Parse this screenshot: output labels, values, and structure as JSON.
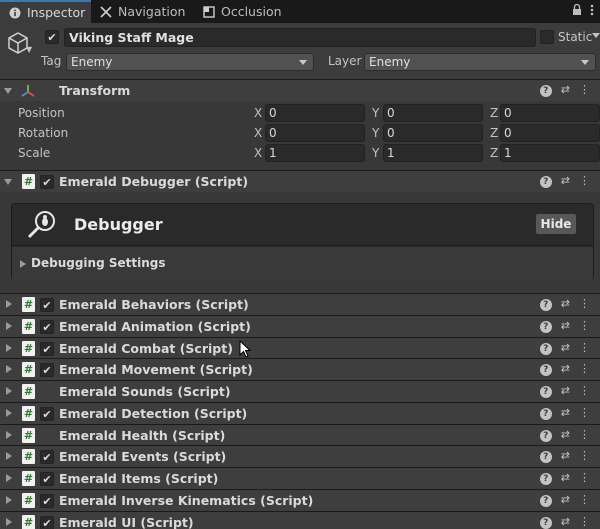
{
  "tabs": [
    {
      "label": "Inspector",
      "icon": "info-icon",
      "active": true
    },
    {
      "label": "Navigation",
      "icon": "navigation-icon",
      "active": false
    },
    {
      "label": "Occlusion",
      "icon": "occlusion-icon",
      "active": false
    }
  ],
  "gameobject": {
    "active": true,
    "name": "Viking Staff Mage",
    "static_label": "Static",
    "tag_label": "Tag",
    "tag_value": "Enemy",
    "layer_label": "Layer",
    "layer_value": "Enemy"
  },
  "transform": {
    "title": "Transform",
    "rows": [
      {
        "label": "Position",
        "x": "0",
        "y": "0",
        "z": "0"
      },
      {
        "label": "Rotation",
        "x": "0",
        "y": "0",
        "z": "0"
      },
      {
        "label": "Scale",
        "x": "1",
        "y": "1",
        "z": "1"
      }
    ],
    "axes": {
      "x": "X",
      "y": "Y",
      "z": "Z"
    }
  },
  "debugger_component": {
    "title": "Emerald Debugger (Script)",
    "panel_title": "Debugger",
    "hide_label": "Hide",
    "section_label": "Debugging Settings"
  },
  "components": [
    {
      "title": "Emerald Behaviors (Script)",
      "has_checkbox": true
    },
    {
      "title": "Emerald Animation (Script)",
      "has_checkbox": true
    },
    {
      "title": "Emerald Combat (Script)",
      "has_checkbox": true
    },
    {
      "title": "Emerald Movement (Script)",
      "has_checkbox": true
    },
    {
      "title": "Emerald Sounds (Script)",
      "has_checkbox": false
    },
    {
      "title": "Emerald Detection (Script)",
      "has_checkbox": true
    },
    {
      "title": "Emerald Health (Script)",
      "has_checkbox": false
    },
    {
      "title": "Emerald Events (Script)",
      "has_checkbox": true
    },
    {
      "title": "Emerald Items (Script)",
      "has_checkbox": true
    },
    {
      "title": "Emerald Inverse Kinematics (Script)",
      "has_checkbox": true
    },
    {
      "title": "Emerald UI (Script)",
      "has_checkbox": true
    }
  ],
  "colors": {
    "accent": "#3a79bb",
    "script_icon": "#2c7a2c"
  }
}
